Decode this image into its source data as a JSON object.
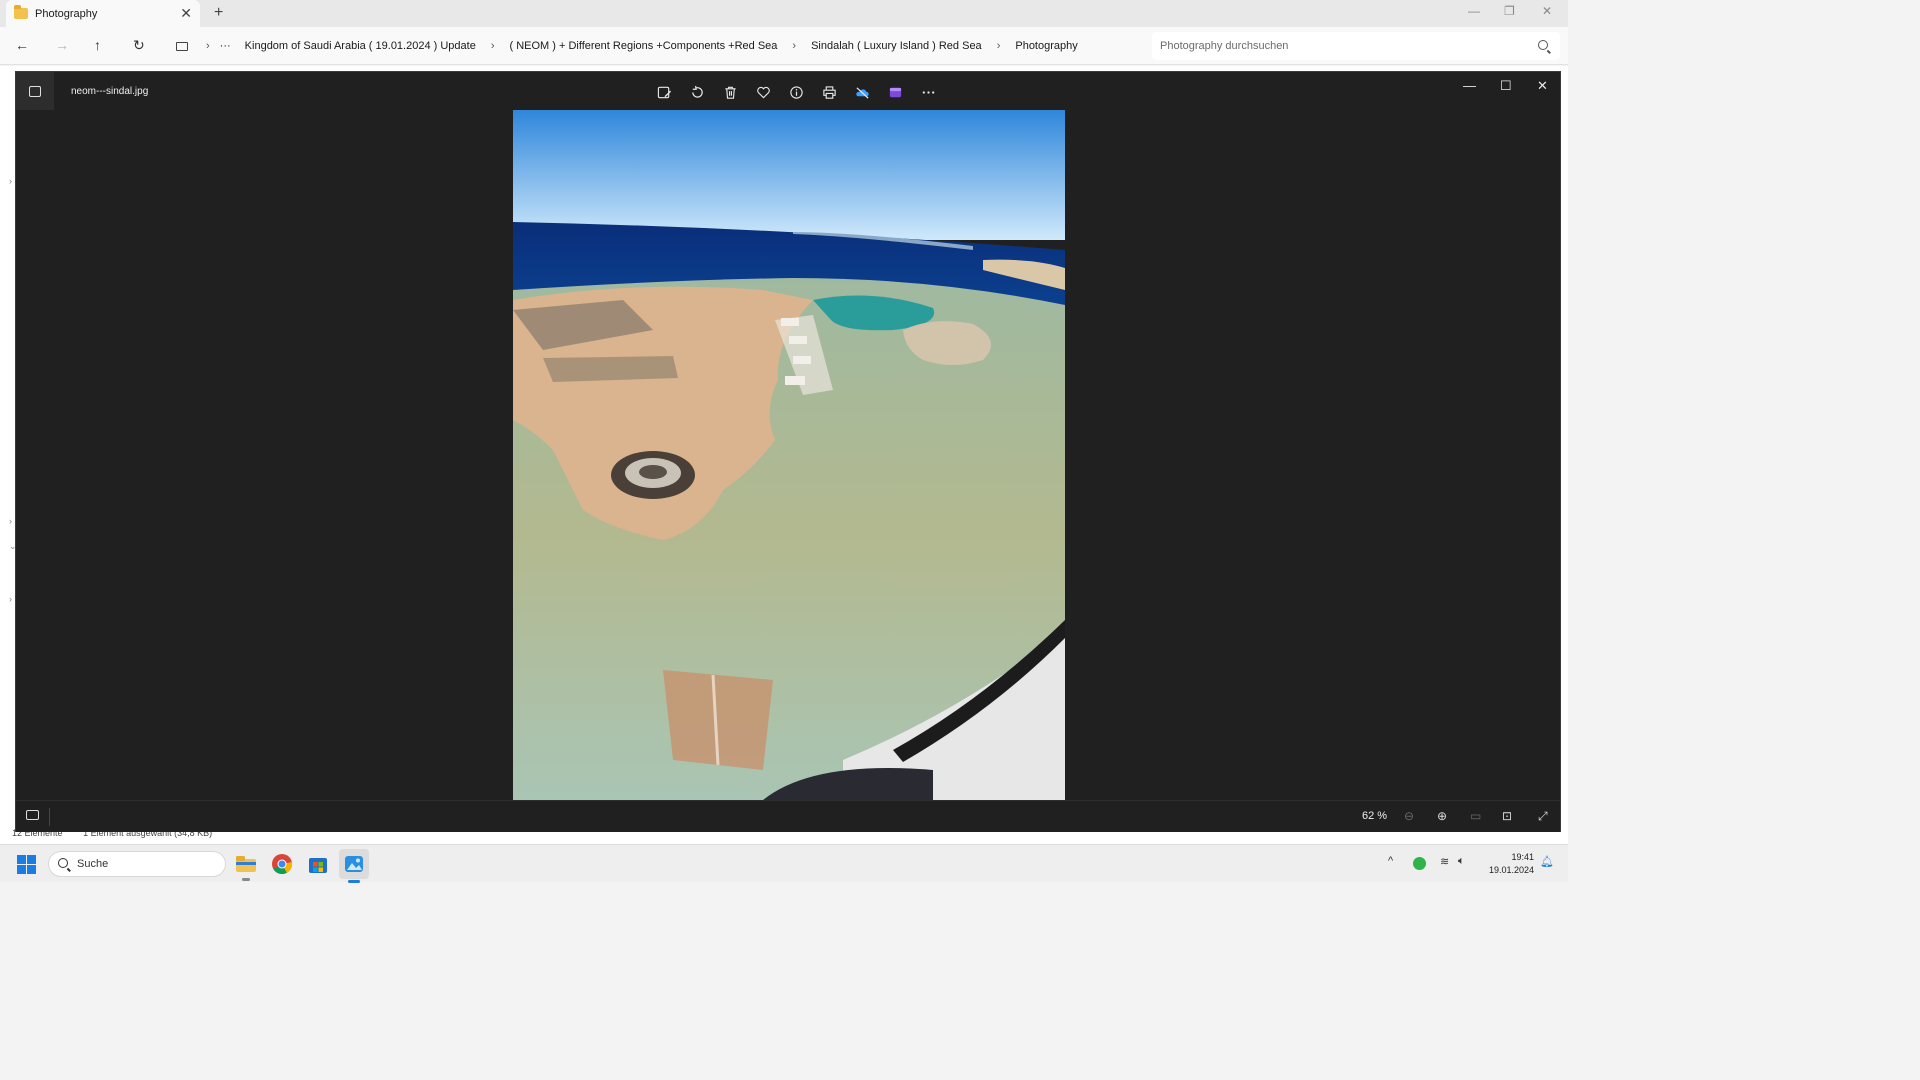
{
  "explorer": {
    "tab_title": "Photography",
    "tab_close_glyph": "✕",
    "new_tab_glyph": "+",
    "nav": {
      "back": "←",
      "forward": "→",
      "up": "↑",
      "refresh": "↻"
    },
    "more_glyph": "···",
    "breadcrumbs": [
      "Kingdom of Saudi Arabia ( 19.01.2024 ) Update",
      "( NEOM ) + Different Regions +Components +Red Sea",
      "Sindalah ( Luxury Island ) Red Sea",
      "Photography"
    ],
    "breadcrumb_sep": "›",
    "search_placeholder": "Photography durchsuchen",
    "status_items": "12 Elemente",
    "status_selected": "1 Element ausgewählt (34,8 KB)"
  },
  "viewer": {
    "filename": "neom---sindal.jpg",
    "toolbar_icons": [
      "edit-image-icon",
      "rotate-icon",
      "delete-icon",
      "favorite-icon",
      "info-icon",
      "print-icon",
      "onedrive-icon",
      "clipchamp-icon",
      "more-icon"
    ],
    "zoom_level": "62 %",
    "window_controls": {
      "minimize": "—",
      "maximize": "☐",
      "close": "✕"
    }
  },
  "taskbar": {
    "search_label": "Suche",
    "time": "19:41",
    "date": "19.01.2024"
  },
  "colors": {
    "viewer_bg": "#202020",
    "accent": "#1b7de0",
    "sea_deep": "#0b3a8c",
    "lagoon": "#2a9d9a",
    "sand": "#d9b48e"
  }
}
